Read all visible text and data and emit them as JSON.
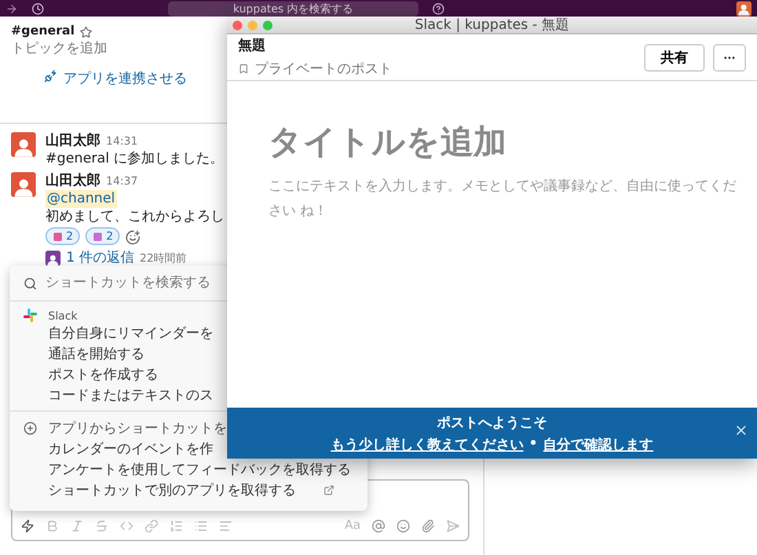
{
  "top_bar": {
    "search": {
      "placeholder": "kuppates 内を検索する"
    }
  },
  "channel": {
    "name": "#general",
    "topic": "トピックを追加",
    "app_link": "アプリを連携させる"
  },
  "messages": [
    {
      "author": "山田太郎",
      "time": "14:31",
      "text": "#general に参加しました。"
    },
    {
      "author": "山田太郎",
      "time": "14:37",
      "mention": "@channel",
      "text": "初めまして、これからよろし",
      "reactions": [
        {
          "count": "2"
        },
        {
          "count": "2"
        }
      ],
      "thread": {
        "replies": "1 件の返信",
        "time": "22時間前"
      }
    }
  ],
  "shortcuts": {
    "placeholder": "ショートカットを検索する",
    "sections": [
      {
        "kind": "slack",
        "title": "Slack",
        "items": [
          {
            "label": "自分自身にリマインダーを",
            "external": false
          },
          {
            "label": "通話を開始する",
            "external": false
          },
          {
            "label": "ポストを作成する",
            "external": false
          },
          {
            "label": "コードまたはテキストのス",
            "external": false
          }
        ]
      },
      {
        "kind": "apps",
        "title": "アプリからショートカットを",
        "items": [
          {
            "label": "カレンダーのイベントを作",
            "external": false
          },
          {
            "label": "アンケートを使用してフィードバックを取得する",
            "external": false
          },
          {
            "label": "ショートカットで別のアプリを取得する",
            "external": true
          }
        ]
      }
    ]
  },
  "composer": {
    "format_label": "Aa"
  },
  "post_window": {
    "title": "Slack | kuppates - 無題",
    "doc_title": "無題",
    "visibility": "プライベートのポスト",
    "share": "共有",
    "heading_placeholder": "タイトルを追加",
    "body_placeholder": "ここにテキストを入力します。メモとしてや議事録など、自由に使ってください ね！",
    "banner": {
      "title": "ポストへようこそ",
      "link_1": "もう少し詳しく教えてください",
      "separator": "•",
      "link_2": "自分で確認します"
    }
  }
}
